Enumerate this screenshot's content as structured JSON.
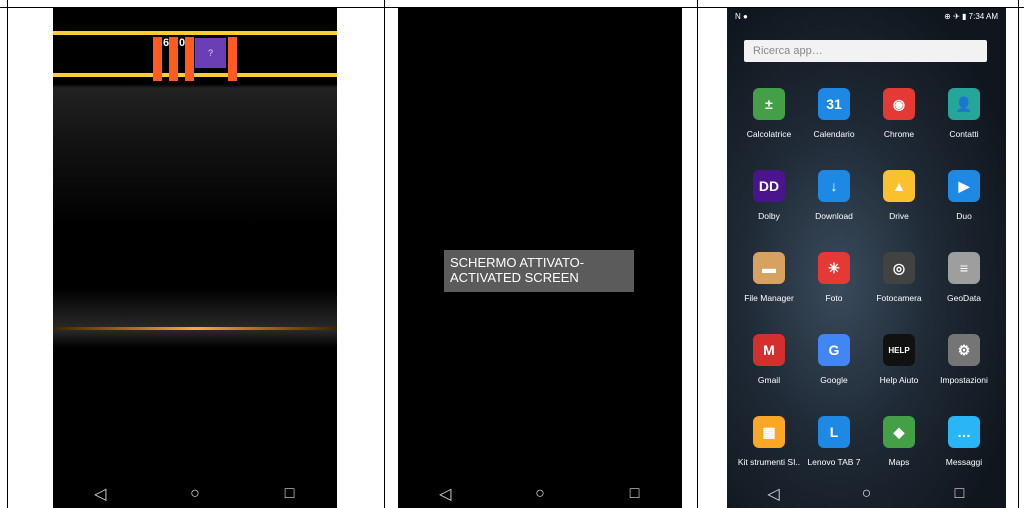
{
  "screen1": {
    "digits": [
      "6",
      "0"
    ],
    "question": "?"
  },
  "screen2": {
    "toast_text": "SCHERMO ATTIVATO-ACTIVATED SCREEN"
  },
  "screen3": {
    "status": {
      "left_icons": "N ●",
      "right": "⊕ ✈ ▮ 7:34 AM"
    },
    "search_placeholder": "Ricerca app…",
    "apps": [
      {
        "label": "Calcolatrice",
        "icon": "calculator-icon",
        "glyph": "±",
        "color": "#43a047"
      },
      {
        "label": "Calendario",
        "icon": "calendar-icon",
        "glyph": "31",
        "color": "#1e88e5"
      },
      {
        "label": "Chrome",
        "icon": "chrome-icon",
        "glyph": "◉",
        "color": "#e53935"
      },
      {
        "label": "Contatti",
        "icon": "contacts-icon",
        "glyph": "👤",
        "color": "#26a69a"
      },
      {
        "label": "Dolby",
        "icon": "dolby-icon",
        "glyph": "DD",
        "color": "#4a148c"
      },
      {
        "label": "Download",
        "icon": "download-icon",
        "glyph": "↓",
        "color": "#1e88e5"
      },
      {
        "label": "Drive",
        "icon": "drive-icon",
        "glyph": "▲",
        "color": "#fbc02d"
      },
      {
        "label": "Duo",
        "icon": "duo-icon",
        "glyph": "▶",
        "color": "#1e88e5"
      },
      {
        "label": "File Manager",
        "icon": "folder-icon",
        "glyph": "▬",
        "color": "#d7a25f"
      },
      {
        "label": "Foto",
        "icon": "photos-icon",
        "glyph": "✳",
        "color": "#e53935"
      },
      {
        "label": "Fotocamera",
        "icon": "camera-icon",
        "glyph": "◎",
        "color": "#424242"
      },
      {
        "label": "GeoData",
        "icon": "database-icon",
        "glyph": "≡",
        "color": "#9e9e9e"
      },
      {
        "label": "Gmail",
        "icon": "gmail-icon",
        "glyph": "M",
        "color": "#d32f2f"
      },
      {
        "label": "Google",
        "icon": "google-icon",
        "glyph": "G",
        "color": "#4285f4"
      },
      {
        "label": "Help Aiuto",
        "icon": "help-icon",
        "glyph": "HELP",
        "color": "#111111"
      },
      {
        "label": "Impostazioni",
        "icon": "settings-icon",
        "glyph": "⚙",
        "color": "#757575"
      },
      {
        "label": "Kit strumenti SI..",
        "icon": "toolkit-icon",
        "glyph": "▦",
        "color": "#f9a825"
      },
      {
        "label": "Lenovo TAB 7",
        "icon": "lenovo-icon",
        "glyph": "L",
        "color": "#1e88e5"
      },
      {
        "label": "Maps",
        "icon": "maps-icon",
        "glyph": "◆",
        "color": "#43a047"
      },
      {
        "label": "Messaggi",
        "icon": "messages-icon",
        "glyph": "…",
        "color": "#29b6f6"
      }
    ]
  }
}
